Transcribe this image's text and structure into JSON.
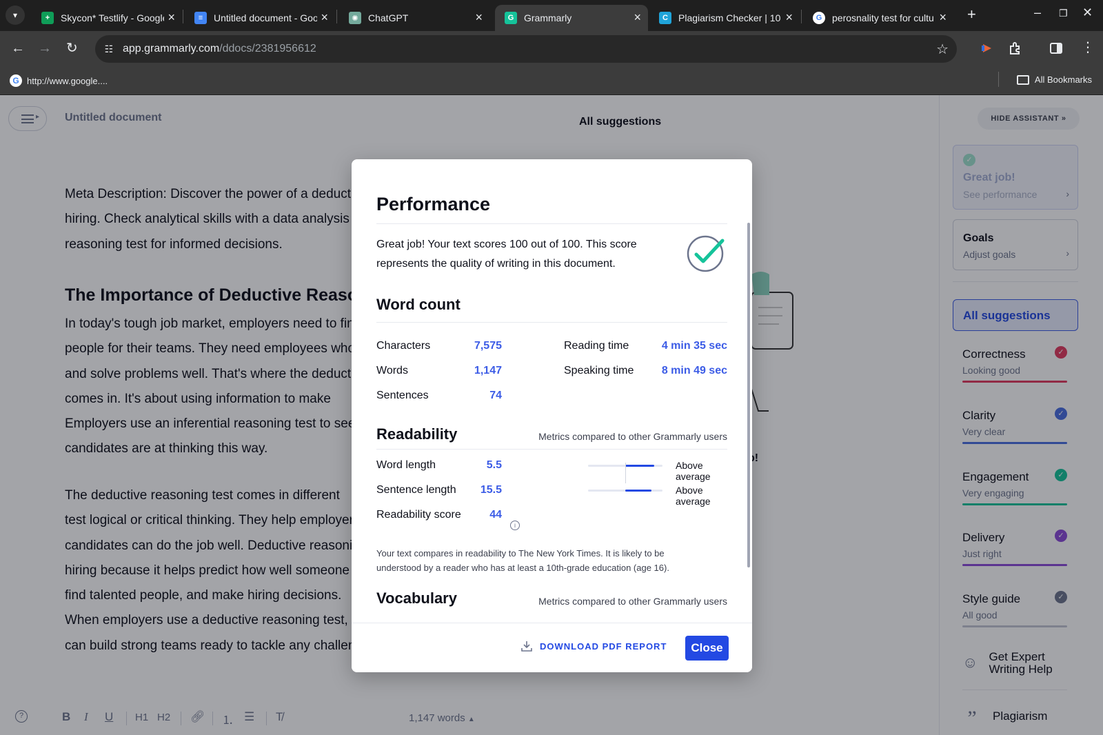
{
  "browser": {
    "tabs": [
      {
        "title": "Skycon* Testlify - Google",
        "color": "#0f9d58",
        "glyph": "+"
      },
      {
        "title": "Untitled document - Goo",
        "color": "#4285f4",
        "glyph": "≡"
      },
      {
        "title": "ChatGPT",
        "color": "#74aa9c",
        "glyph": "✺"
      },
      {
        "title": "Grammarly",
        "color": "#15c39a",
        "glyph": "G"
      },
      {
        "title": "Plagiarism Checker | 10",
        "color": "#20a4d9",
        "glyph": "C"
      },
      {
        "title": "perosnality test for cultu",
        "color": "#ffffff",
        "glyph": "G"
      }
    ],
    "url_host": "app.grammarly.com",
    "url_path": "/ddocs/2381956612",
    "bookmark": "http://www.google....",
    "all_bookmarks": "All Bookmarks"
  },
  "editor": {
    "doc_title": "Untitled document",
    "header": "All suggestions",
    "para1": [
      "Meta Description: Discover the power of a deductive",
      "hiring. Check analytical skills with a data analysis",
      "reasoning test for informed decisions."
    ],
    "heading": "The Importance of Deductive Reasoning",
    "para2": [
      "In today's tough job market, employers need to find",
      "people for their teams. They need employees who",
      "and solve problems well. That's where the deductive",
      "comes in. It's about using information to make",
      "Employers use an inferential reasoning test to see",
      "candidates are at thinking this way."
    ],
    "para3": [
      "The deductive reasoning test comes in different",
      "test logical or critical thinking. They help employers",
      "candidates can do the job well. Deductive reasoning",
      "hiring because it helps predict how well someone",
      "find talented people, and make hiring decisions.",
      "When employers use a deductive reasoning test,",
      "can build strong teams ready to tackle any challenge."
    ],
    "illustration_text": "b!",
    "word_count": "1,147 words"
  },
  "sidebar": {
    "hide_assistant": "HIDE ASSISTANT",
    "performance_title": "Great job!",
    "performance_sub": "See performance",
    "goals_title": "Goals",
    "goals_sub": "Adjust goals",
    "all_suggestions": "All suggestions",
    "categories": [
      {
        "name": "Correctness",
        "status": "Looking good",
        "color": "#e23b5f"
      },
      {
        "name": "Clarity",
        "status": "Very clear",
        "color": "#4a6ee0"
      },
      {
        "name": "Engagement",
        "status": "Very engaging",
        "color": "#15c39a"
      },
      {
        "name": "Delivery",
        "status": "Just right",
        "color": "#8b4bd8"
      },
      {
        "name": "Style guide",
        "status": "All good",
        "color": "#6d758d"
      }
    ],
    "expert_help": "Get Expert Writing Help",
    "plagiarism": "Plagiarism"
  },
  "modal": {
    "title": "Performance",
    "summary": "Great job! Your text scores 100 out of 100. This score represents the quality of writing in this document.",
    "word_count_title": "Word count",
    "stats": {
      "characters_label": "Characters",
      "characters": "7,575",
      "words_label": "Words",
      "words": "1,147",
      "sentences_label": "Sentences",
      "sentences": "74",
      "reading_label": "Reading time",
      "reading": "4 min 35 sec",
      "speaking_label": "Speaking time",
      "speaking": "8 min 49 sec"
    },
    "readability_title": "Readability",
    "metrics_note": "Metrics compared to other Grammarly users",
    "readability": {
      "word_length_label": "Word length",
      "word_length": "5.5",
      "word_length_rating": "Above average",
      "sentence_length_label": "Sentence length",
      "sentence_length": "15.5",
      "sentence_length_rating": "Above average",
      "score_label": "Readability score",
      "score": "44"
    },
    "readability_note": "Your text compares in readability to The New York Times. It is likely to be understood by a reader who has at least a 10th-grade education (age 16).",
    "vocabulary_title": "Vocabulary",
    "download": "DOWNLOAD PDF REPORT",
    "close": "Close"
  },
  "colors": {
    "accent": "#2349e3",
    "stat_value": "#3c5ce6",
    "success": "#15c39a"
  }
}
